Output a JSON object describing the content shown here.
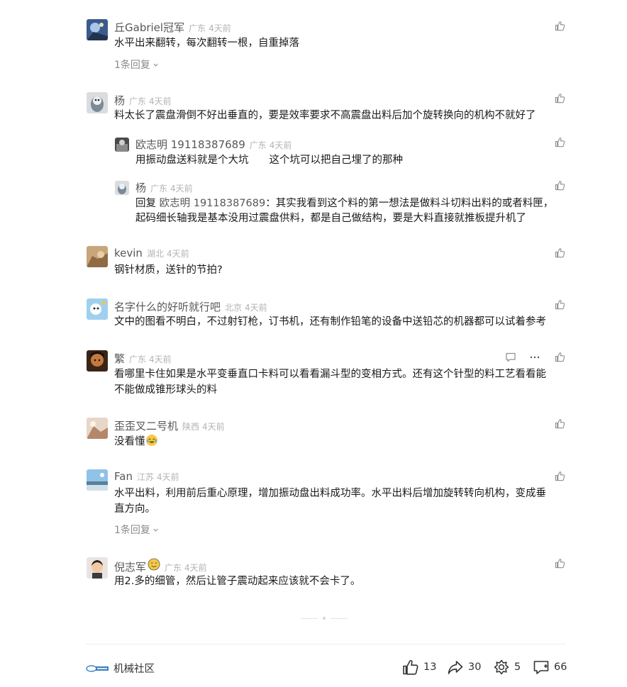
{
  "comments": [
    {
      "name": "丘Gabriel冠军",
      "location": "广东",
      "time": "4天前",
      "text": "水平出来翻转，每次翻转一根，自重掉落",
      "replies": "1条回复"
    },
    {
      "name": "杨",
      "location": "广东",
      "time": "4天前",
      "text": "料太长了震盘滑倒不好出垂直的，要是效率要求不高震盘出料后加个旋转换向的机构不就好了",
      "sub": [
        {
          "name": "欧志明 19118387689",
          "location": "广东",
          "time": "4天前",
          "text": "用振动盘送料就是个大坑　　这个坑可以把自己埋了的那种"
        },
        {
          "name": "杨",
          "location": "广东",
          "time": "4天前",
          "reply_prefix": "回复",
          "reply_to": "欧志明 19118387689",
          "text_line1": "：其实我看到这个料的第一想法是做料斗切料出料的或者料匣，",
          "text_line2": "起码细长轴我是基本没用过震盘供料，都是自己做结构，要是大料直接就推板提升机了"
        }
      ]
    },
    {
      "name": "kevin",
      "location": "湖北",
      "time": "4天前",
      "text": "钢针材质，送针的节拍?"
    },
    {
      "name": "名字什么的好听就行吧",
      "location": "北京",
      "time": "4天前",
      "text": "文中的图看不明白，不过射钉枪，订书机，还有制作铅笔的设备中送铅芯的机器都可以试着参考"
    },
    {
      "name": "繁",
      "location": "广东",
      "time": "4天前",
      "text_line1": "看哪里卡住如果是水平变垂直口卡料可以看看漏斗型的变相方式。还有这个针型的料工艺看看能",
      "text_line2": "不能做成锥形球头的料"
    },
    {
      "name": "歪歪叉二号机",
      "location": "陕西",
      "time": "4天前",
      "text": "没看懂"
    },
    {
      "name": "Fan",
      "location": "江苏",
      "time": "4天前",
      "text_line1": "水平出料，利用前后重心原理，增加振动盘出料成功率。水平出料后增加旋转转向机构，变成垂",
      "text_line2": "直方向。",
      "replies": "1条回复"
    },
    {
      "name": "倪志军",
      "location": "广东",
      "time": "4天前",
      "text": "用2.多的细管，然后让管子震动起来应该就不会卡了。"
    }
  ],
  "footer": {
    "brand": "机械社区",
    "likes": "13",
    "shares": "30",
    "recommends": "5",
    "comments": "66"
  },
  "icons": {
    "like": "thumbs-up-icon",
    "reply": "comment-bubble-icon",
    "more": "more-dots-icon",
    "share": "share-arrow-icon",
    "recommend": "flower-icon"
  },
  "colors": {
    "name": "#575757",
    "meta": "#b3b3b3",
    "text": "#1a1a1a",
    "muted": "#8a8a8a"
  }
}
